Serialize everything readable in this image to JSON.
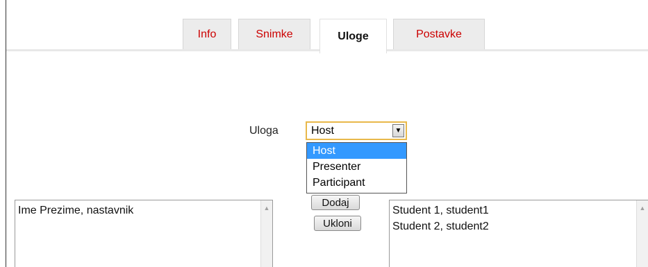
{
  "tabs": [
    {
      "label": "Info",
      "active": false
    },
    {
      "label": "Snimke",
      "active": false
    },
    {
      "label": "Uloge",
      "active": true
    },
    {
      "label": "Postavke",
      "active": false
    }
  ],
  "role_selector": {
    "label": "Uloga",
    "selected": "Host",
    "options": [
      "Host",
      "Presenter",
      "Participant"
    ]
  },
  "left_list": {
    "items": [
      "Ime Prezime, nastavnik"
    ]
  },
  "buttons": {
    "add": "Dodaj",
    "remove": "Ukloni"
  },
  "right_list": {
    "items": [
      "Student 1, student1",
      "Student 2, student2"
    ]
  },
  "icons": {
    "select_arrow": "chevron-down-icon",
    "scroll_up": "scroll-up-arrow-icon"
  }
}
